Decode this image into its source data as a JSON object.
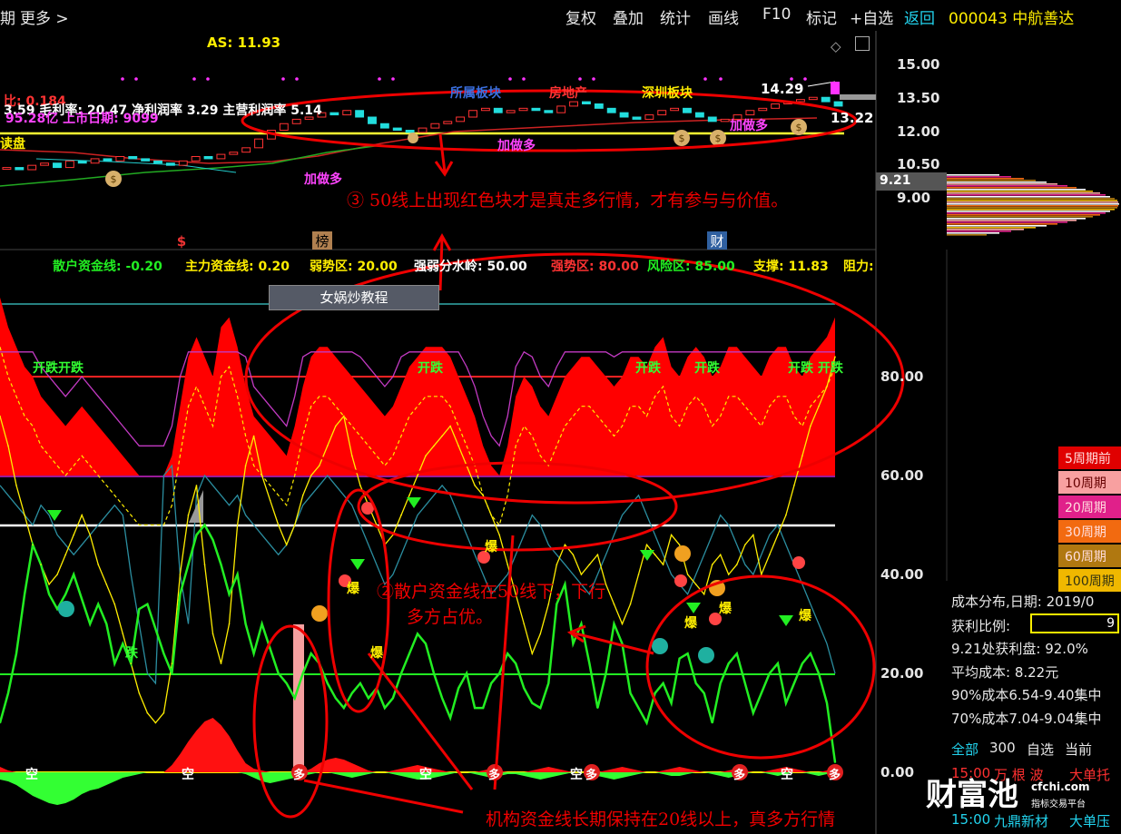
{
  "toolbar": {
    "left_frag": "期",
    "more": "更多 >",
    "items": [
      "复权",
      "叠加",
      "统计",
      "画线",
      "F10",
      "标记",
      "+自选"
    ],
    "back": "返回",
    "stock_code": "000043 中航善达"
  },
  "price_panel": {
    "as_label": "AS: 11.93",
    "fin_line1": "3.59 毛利率: 20.47 净利润率 3.29 主营利润率 5.14",
    "fin_line2": "95.28亿 上市日期: 9099",
    "red_frag": "比: 0.184",
    "left_frag": "读盘",
    "sectors": [
      "所属板块",
      "房地产",
      "深圳板块"
    ],
    "signals": [
      "加做多",
      "加做多",
      "加做多"
    ],
    "high_label": "14.29",
    "low_label": "13.22",
    "current_price": "9.21",
    "y_axis": [
      "15.00",
      "13.50",
      "12.00",
      "10.50",
      "9.00"
    ],
    "event_marks": [
      "$",
      "榜",
      "财"
    ]
  },
  "indicator_panel": {
    "header": [
      {
        "label": "散户资金线: -0.20",
        "color": "#22ee22"
      },
      {
        "label": "主力资金线: 0.20",
        "color": "#ffee00"
      },
      {
        "label": "弱势区: 20.00",
        "color": "#ffee00"
      },
      {
        "label": "强弱分水岭: 50.00",
        "color": "#ffffff"
      },
      {
        "label": "强势区: 80.00",
        "color": "#ff3333"
      },
      {
        "label": "风险区: 85.00",
        "color": "#22ee22"
      },
      {
        "label": "支撑: 11.83",
        "color": "#ffee00"
      },
      {
        "label": "阻力:",
        "color": "#ffee00"
      }
    ],
    "teaching_box": "女娲炒教程",
    "y_axis": [
      "80.00",
      "60.00",
      "40.00",
      "20.00",
      "0.00"
    ],
    "kai_die": [
      "开跌开跌",
      "开跌",
      "开跌",
      "开跌",
      "开跌 开跌"
    ],
    "die": "跌",
    "bao": "爆",
    "kong": "空",
    "duo": "多"
  },
  "chart_data": {
    "type": "line",
    "title": "",
    "price_axis": {
      "ylim": [
        9.0,
        15.0
      ],
      "ticks": [
        15.0,
        13.5,
        12.0,
        10.5,
        9.0
      ]
    },
    "indicator_axis": {
      "ylim": [
        0,
        85
      ],
      "ticks": [
        80,
        60,
        40,
        20,
        0
      ]
    },
    "reference_lines": [
      {
        "name": "强势区",
        "value": 80,
        "color": "#ff3333"
      },
      {
        "name": "风险区",
        "value": 85,
        "color": "#22ee22"
      },
      {
        "name": "强弱分水岭",
        "value": 50,
        "color": "#ffffff"
      },
      {
        "name": "弱势区",
        "value": 20,
        "color": "#22ee22"
      }
    ],
    "series": [
      {
        "name": "散户资金线",
        "color": "#22ee22",
        "values": [
          10,
          16,
          24,
          36,
          46,
          42,
          36,
          33,
          36,
          40,
          35,
          30,
          34,
          30,
          22,
          26,
          22,
          33,
          34,
          29,
          24,
          20,
          36,
          42,
          48,
          50,
          47,
          42,
          36,
          40,
          30,
          24,
          30,
          25,
          20,
          18,
          15,
          20,
          24,
          22,
          18,
          15,
          13,
          16,
          18,
          15,
          17,
          13,
          15,
          20,
          24,
          28,
          26,
          20,
          15,
          11,
          17,
          20,
          13,
          13,
          18,
          20,
          24,
          22,
          17,
          14,
          13,
          18,
          34,
          38,
          26,
          30,
          22,
          13,
          20,
          30,
          26,
          16,
          13,
          10,
          16,
          18,
          14,
          23,
          24,
          18,
          16,
          10,
          18,
          22,
          24,
          18,
          12,
          16,
          20,
          22,
          14,
          18,
          22,
          24,
          20,
          14,
          2
        ]
      },
      {
        "name": "主力资金线",
        "color": "#ffee00",
        "values": [
          72,
          66,
          58,
          52,
          46,
          42,
          38,
          40,
          44,
          48,
          52,
          48,
          42,
          38,
          34,
          28,
          22,
          16,
          12,
          10,
          12,
          22,
          40,
          52,
          58,
          42,
          28,
          22,
          30,
          50,
          62,
          68,
          60,
          55,
          50,
          46,
          50,
          56,
          60,
          62,
          66,
          70,
          72,
          64,
          58,
          54,
          50,
          46,
          48,
          52,
          56,
          60,
          64,
          66,
          68,
          70,
          66,
          62,
          58,
          56,
          52,
          48,
          42,
          36,
          30,
          24,
          28,
          34,
          42,
          46,
          44,
          40,
          42,
          44,
          38,
          34,
          30,
          34,
          40,
          46,
          44,
          42,
          48,
          46,
          40,
          38,
          36,
          42,
          44,
          40,
          42,
          46,
          48,
          40,
          44,
          48,
          52,
          58,
          64,
          70,
          74,
          78,
          84
        ]
      }
    ],
    "histogram_lines": [
      "5周期",
      "10周期",
      "20周期",
      "30周期",
      "60周期",
      "100周期"
    ]
  },
  "legend": [
    "5周期前",
    "10周期",
    "20周期",
    "30周期",
    "60周期",
    "100周期"
  ],
  "cost_box": {
    "title": "成本分布,日期: 2019/0",
    "profit_ratio_label": "获利比例:",
    "profit_ratio_value": "9",
    "lines": [
      "9.21处获利盘: 92.0%",
      "平均成本: 8.22元",
      "90%成本6.54-9.40集中",
      "70%成本7.04-9.04集中"
    ],
    "tabs": [
      "全部",
      "300",
      "自选",
      "当前"
    ]
  },
  "ticker": [
    {
      "time": "15:00",
      "name": "万 根 波",
      "tag": "大单托"
    },
    {
      "time": "15:00",
      "name": "九鼎新材",
      "tag": "大单压"
    }
  ],
  "annotations": {
    "a3": "③ 50线上出现红色块才是真走多行情，才有参与与价值。",
    "a2_line1": "②散户资金线在50线下，下行",
    "a2_line2": "多方占优。",
    "a1": "机构资金线长期保持在20线以上，真多方行情"
  },
  "watermark": {
    "brand": "财富池",
    "site": "cfchi.com",
    "slogan": "指标交易平台"
  }
}
